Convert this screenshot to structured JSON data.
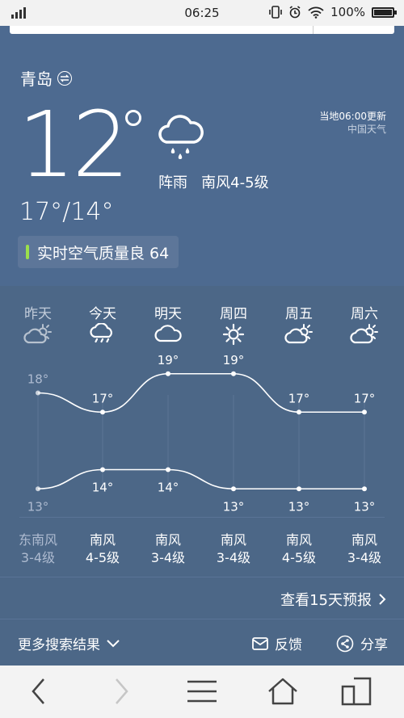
{
  "status_bar": {
    "time": "06:25",
    "battery": "100%"
  },
  "city": {
    "name": "青岛"
  },
  "update": {
    "time_text": "当地06:00更新",
    "source": "中国天气"
  },
  "current": {
    "temp": "12",
    "condition": "阵雨",
    "wind": "南风4-5级",
    "hilo": "17°/14°",
    "aqi_text": "实时空气质量良 64",
    "aqi_color": "#9be04b"
  },
  "forecast": {
    "days": [
      {
        "name": "昨天",
        "icon": "partly-cloudy-icon",
        "high": "18°",
        "low": "13°",
        "wind_dir": "东南风",
        "wind_level": "3-4级",
        "past": true
      },
      {
        "name": "今天",
        "icon": "rain-icon",
        "high": "17°",
        "low": "14°",
        "wind_dir": "南风",
        "wind_level": "4-5级",
        "past": false
      },
      {
        "name": "明天",
        "icon": "cloudy-icon",
        "high": "19°",
        "low": "14°",
        "wind_dir": "南风",
        "wind_level": "3-4级",
        "past": false
      },
      {
        "name": "周四",
        "icon": "sunny-icon",
        "high": "19°",
        "low": "13°",
        "wind_dir": "南风",
        "wind_level": "3-4级",
        "past": false
      },
      {
        "name": "周五",
        "icon": "partly-cloudy-icon",
        "high": "17°",
        "low": "13°",
        "wind_dir": "南风",
        "wind_level": "4-5级",
        "past": false
      },
      {
        "name": "周六",
        "icon": "partly-cloudy-icon",
        "high": "17°",
        "low": "13°",
        "wind_dir": "南风",
        "wind_level": "3-4级",
        "past": false
      }
    ]
  },
  "chart_data": {
    "type": "line",
    "categories": [
      "昨天",
      "今天",
      "明天",
      "周四",
      "周五",
      "周六"
    ],
    "series": [
      {
        "values": [
          18,
          17,
          19,
          19,
          17,
          17
        ]
      },
      {
        "values": [
          13,
          14,
          14,
          13,
          13,
          13
        ]
      }
    ],
    "ylim": [
      12,
      20
    ]
  },
  "links": {
    "more_forecast": "查看15天预报",
    "more_results": "更多搜索结果",
    "feedback": "反馈",
    "share": "分享"
  }
}
